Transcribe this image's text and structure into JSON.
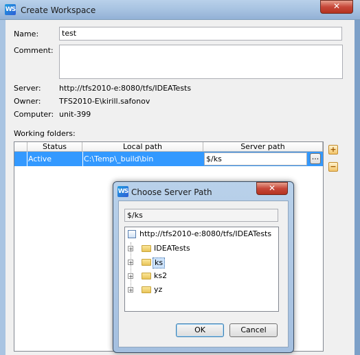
{
  "window": {
    "title": "Create Workspace",
    "logo_text": "WS",
    "close_glyph": "✕"
  },
  "form": {
    "name_label": "Name:",
    "name_value": "test",
    "comment_label": "Comment:",
    "comment_value": "",
    "server_label": "Server:",
    "server_value": "http://tfs2010-e:8080/tfs/IDEATests",
    "owner_label": "Owner:",
    "owner_value": "TFS2010-E\\kirill.safonov",
    "computer_label": "Computer:",
    "computer_value": "unit-399",
    "working_folders_label": "Working folders:"
  },
  "table": {
    "columns": [
      "Status",
      "Local path",
      "Server path"
    ],
    "rows": [
      {
        "status": "Active",
        "local_path": "C:\\Temp\\_build\\bin",
        "server_path": "$/ks",
        "browse": "..."
      }
    ]
  },
  "side_buttons": {
    "add": "+",
    "remove": "−"
  },
  "dialog": {
    "title": "Choose Server Path",
    "logo_text": "WS",
    "close_glyph": "✕",
    "path_value": "$/ks",
    "tree_root": "http://tfs2010-e:8080/tfs/IDEATests",
    "tree_items": [
      "IDEATests",
      "ks",
      "ks2",
      "yz"
    ],
    "selected_item": "ks",
    "ok_label": "OK",
    "cancel_label": "Cancel"
  },
  "colors": {
    "selection": "#3399ff",
    "accent": "#2e5fd6"
  }
}
